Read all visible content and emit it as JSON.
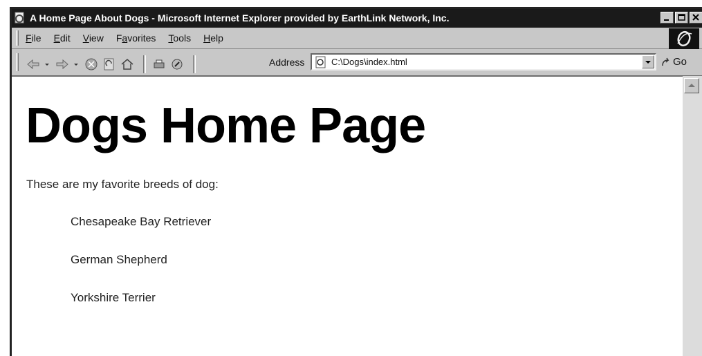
{
  "window": {
    "title": "A Home Page About Dogs - Microsoft Internet Explorer provided by EarthLink Network, Inc."
  },
  "menu": {
    "items": [
      {
        "label": "File",
        "accel": "F",
        "rest": "ile"
      },
      {
        "label": "Edit",
        "accel": "E",
        "rest": "dit"
      },
      {
        "label": "View",
        "accel": "V",
        "rest": "iew"
      },
      {
        "label": "Favorites",
        "pre": "F",
        "accel": "a",
        "rest": "vorites"
      },
      {
        "label": "Tools",
        "accel": "T",
        "rest": "ools"
      },
      {
        "label": "Help",
        "accel": "H",
        "rest": "elp"
      }
    ]
  },
  "toolbar": {
    "address_label": "Address",
    "address_value": "C:\\Dogs\\index.html",
    "go_label": "Go",
    "icons": [
      "back-icon",
      "forward-icon",
      "stop-icon",
      "refresh-icon",
      "home-icon",
      "print-icon",
      "edit-icon"
    ]
  },
  "page": {
    "heading": "Dogs Home Page",
    "intro": "These are my favorite breeds of dog:",
    "breeds": [
      "Chesapeake Bay Retriever",
      "German Shepherd",
      "Yorkshire Terrier"
    ]
  },
  "colors": {
    "titlebar": "#1a1a1a",
    "chrome": "#c8c8c8",
    "content_bg": "#ffffff"
  }
}
